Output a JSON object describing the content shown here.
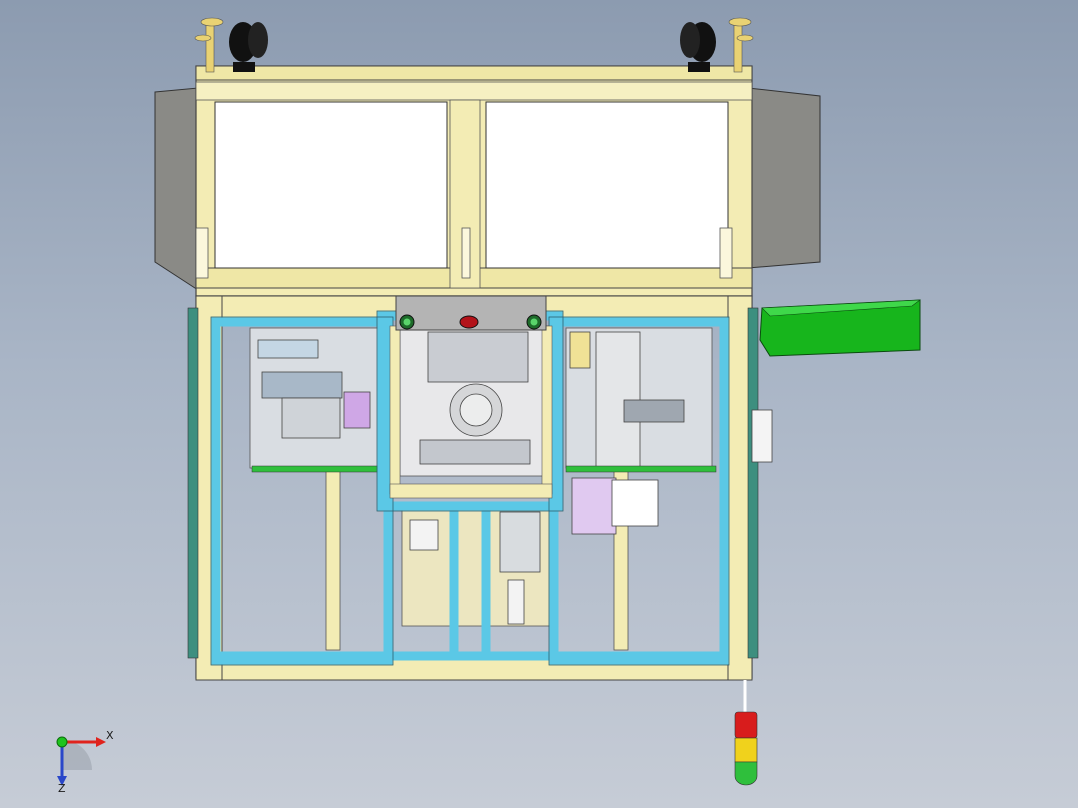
{
  "viewport": {
    "background_top": "#8c9bb0",
    "background_bottom": "#c6ccd6"
  },
  "model": {
    "frame_color": "#f3ecb4",
    "guard_color": "#5bc8e6",
    "cover_color": "#8a8a86",
    "tray_color": "#17b51c",
    "panel_color": "#ffffff"
  },
  "triad": {
    "x_label": "X",
    "z_label": "Z",
    "x_color": "#e0231d",
    "z_color": "#2a47c9",
    "y_color": "#1ec41e"
  },
  "stack_light": [
    "#d81c1c",
    "#f0d21c",
    "#2fbf3c"
  ]
}
